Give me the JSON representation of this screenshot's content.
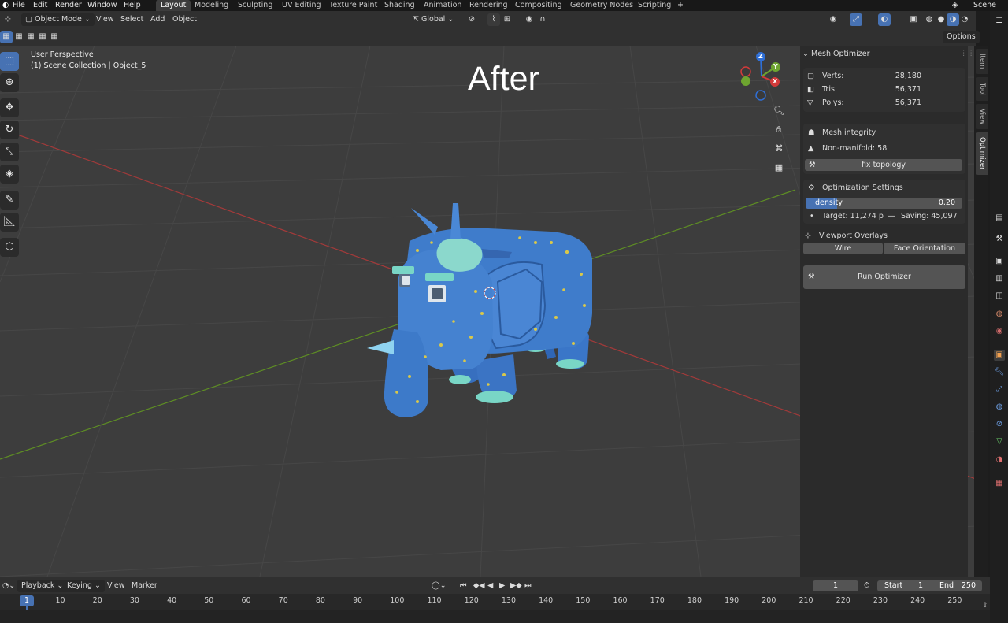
{
  "menu": {
    "items": [
      "File",
      "Edit",
      "Render",
      "Window",
      "Help"
    ],
    "workspaces": [
      "Layout",
      "Modeling",
      "Sculpting",
      "UV Editing",
      "Texture Paint",
      "Shading",
      "Animation",
      "Rendering",
      "Compositing",
      "Geometry Nodes",
      "Scripting"
    ],
    "active_workspace": "Layout",
    "add_workspace": "+",
    "scene": "Scene"
  },
  "header": {
    "mode": "Object Mode",
    "view": "View",
    "select": "Select",
    "add": "Add",
    "object": "Object",
    "orientation": "Global",
    "options": "Options"
  },
  "viewport": {
    "perspective": "User Perspective",
    "collection": "(1) Scene Collection | Object_5",
    "overlay_title": "After",
    "gizmo": {
      "x": "X",
      "y": "Y",
      "z": "Z"
    },
    "colors": {
      "background": "#3d3d3d",
      "x_axis": "#b23b3b",
      "y_axis": "#6a9a2a",
      "model": "#3f78c9"
    }
  },
  "panel": {
    "title": "Mesh Optimizer",
    "stats": [
      {
        "label": "Verts:",
        "value": "28,180"
      },
      {
        "label": "Tris:",
        "value": "56,371"
      },
      {
        "label": "Polys:",
        "value": "56,371"
      }
    ],
    "integrity": {
      "title": "Mesh integrity",
      "warning": "Non-manifold: 58",
      "fix_button": "fix topology"
    },
    "settings": {
      "title": "Optimization Settings",
      "density_label": "density",
      "density_value": "0.20",
      "density_fraction": 0.2,
      "target": "Target: 11,274 p",
      "saving": "Saving: 45,097",
      "sep": "—",
      "bullet": "•"
    },
    "overlays": {
      "title": "Viewport Overlays",
      "wire": "Wire",
      "face_orientation": "Face Orientation"
    },
    "run_button": "Run Optimizer"
  },
  "sidetabs": [
    "Item",
    "Tool",
    "View",
    "Optimizer"
  ],
  "active_sidetab": "Optimizer",
  "timeline": {
    "playback": "Playback",
    "keying": "Keying",
    "view": "View",
    "marker": "Marker",
    "current_frame": "1",
    "start_label": "Start",
    "start": "1",
    "end_label": "End",
    "end": "250",
    "ticks": [
      "10",
      "20",
      "30",
      "40",
      "50",
      "60",
      "70",
      "80",
      "90",
      "100",
      "110",
      "120",
      "130",
      "140",
      "150",
      "160",
      "170",
      "180",
      "190",
      "200",
      "210",
      "220",
      "230",
      "240",
      "250"
    ],
    "cursor_frame": "1"
  }
}
